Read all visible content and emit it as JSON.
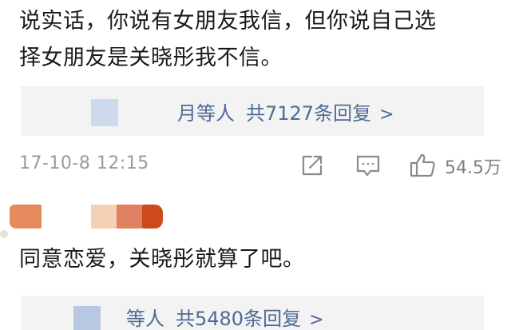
{
  "comment1": {
    "line1": "说实话，你说有女朋友我信，但你说自己选",
    "line2": "择女朋友是关晓彤我不信。",
    "replies": {
      "users": "月等人",
      "total": "共7127条回复",
      "arrow": ">"
    },
    "timestamp": "17-10-8 12:15",
    "likes": "54.5万"
  },
  "comment2": {
    "text": "同意恋爱，关晓彤就算了吧。",
    "replies": {
      "users": "等人",
      "total": "共5480条回复",
      "arrow": ">"
    }
  },
  "colors": {
    "reply_link": "#4f6a96",
    "meta_gray": "#9a9a9a",
    "reply_bg": "#f3f3f3",
    "redaction_orange": "#e58a5c",
    "redaction_dark_orange": "#cc4a1c"
  },
  "icons": [
    "share-icon",
    "comment-icon",
    "like-icon"
  ]
}
